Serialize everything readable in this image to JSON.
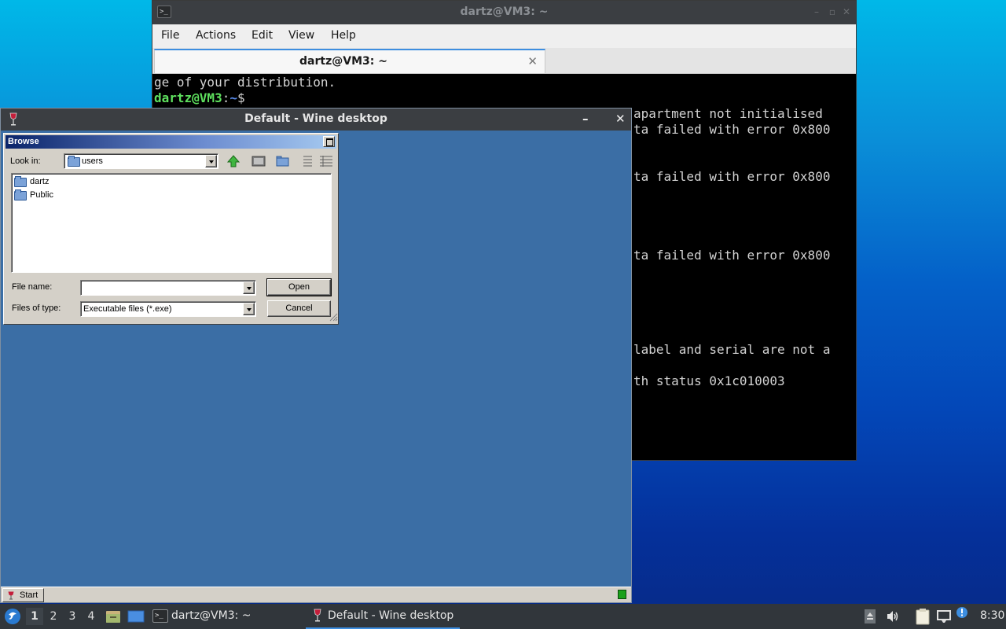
{
  "terminal": {
    "title": "dartz@VM3: ~",
    "menu": [
      "File",
      "Actions",
      "Edit",
      "View",
      "Help"
    ],
    "tab_label": "dartz@VM3: ~",
    "tab_close": "✕",
    "output": {
      "line1": "ge of your distribution.",
      "prompt_user": "dartz@VM3",
      "prompt_sep": ":",
      "prompt_path": "~",
      "prompt_symbol": "$",
      "right_lines": [
        "apartment not initialised",
        "ta failed with error 0x800",
        "ta failed with error 0x800",
        "ta failed with error 0x800",
        "label and serial are not a",
        "th status 0x1c010003"
      ]
    }
  },
  "wine": {
    "title": "Default - Wine desktop",
    "minimize": "–",
    "close": "✕",
    "start_label": "Start",
    "tray_led_color": "#1aa01a"
  },
  "browse": {
    "title": "Browse",
    "look_in_label": "Look in:",
    "look_in_value": "users",
    "items": [
      "dartz",
      "Public"
    ],
    "file_name_label": "File name:",
    "file_name_value": "",
    "file_type_label": "Files of type:",
    "file_type_value": "Executable files (*.exe)",
    "open_label": "Open",
    "cancel_label": "Cancel"
  },
  "panel": {
    "workspaces": [
      "1",
      "2",
      "3",
      "4"
    ],
    "active_workspace": "1",
    "task_terminal": "dartz@VM3: ~",
    "task_wine": "Default - Wine desktop",
    "clock": "8:30",
    "accent": "#3d8ee0"
  }
}
